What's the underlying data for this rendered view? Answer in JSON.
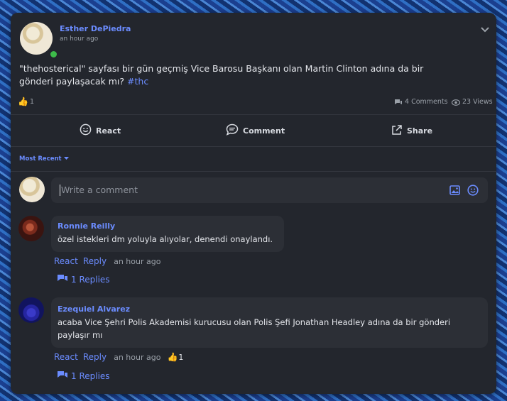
{
  "post": {
    "author": "Esther DePiedra",
    "time": "an hour ago",
    "text": "\"thehosterical\" sayfası bir gün geçmiş Vice Barosu Başkanı olan Martin Clinton adına da bir gönderi paylaşacak mı?",
    "hashtag": "#thc",
    "reaction_count": "1",
    "comments_count": "4 Comments",
    "views_count": "23 Views"
  },
  "actions": {
    "react": "React",
    "comment": "Comment",
    "share": "Share"
  },
  "sort": {
    "label": "Most Recent"
  },
  "composer": {
    "placeholder": "Write a comment"
  },
  "comments": [
    {
      "author": "Ronnie Reilly",
      "text": "özel istekleri dm yoluyla alıyolar, denendi onaylandı.",
      "react": "React",
      "reply": "Reply",
      "time": "an hour ago",
      "replies": "1 Replies"
    },
    {
      "author": "Ezequiel Alvarez",
      "text": "acaba Vice Şehri Polis Akademisi kurucusu olan Polis Şefi Jonathan Headley adına da bir gönderi paylaşır mı",
      "react": "React",
      "reply": "Reply",
      "time": "an hour ago",
      "reaction_count": "1",
      "replies": "1 Replies"
    }
  ],
  "colors": {
    "accent": "#6b8cff",
    "card": "#23262d",
    "online": "#3dbb4a"
  }
}
